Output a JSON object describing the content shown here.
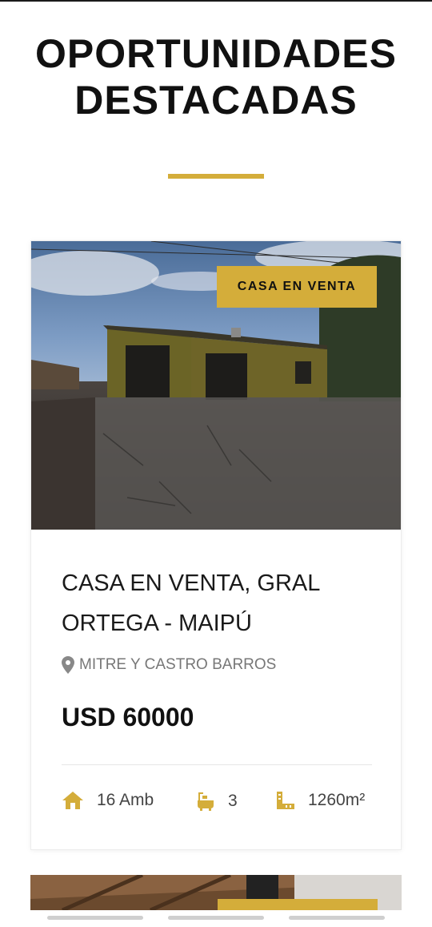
{
  "section": {
    "title_line1": "OPORTUNIDADES",
    "title_line2": "DESTACADAS",
    "accent_color": "#d4ad3a"
  },
  "listing": {
    "badge": "CASA EN VENTA",
    "title": "CASA EN VENTA, GRAL ORTEGA - MAIPÚ",
    "address_icon": "map-pin-icon",
    "address": "MITRE Y CASTRO BARROS",
    "price": "USD 60000",
    "features": [
      {
        "icon": "home-icon",
        "value": "16 Amb"
      },
      {
        "icon": "bathtub-icon",
        "value": "3"
      },
      {
        "icon": "ruler-area-icon",
        "value": "1260m²"
      }
    ]
  }
}
